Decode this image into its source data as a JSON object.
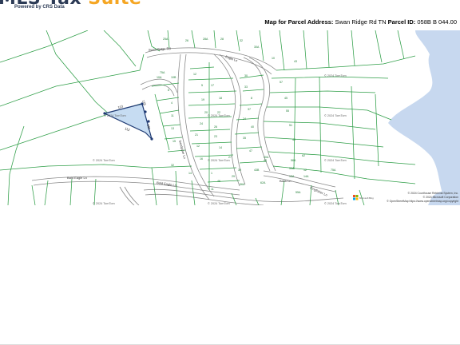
{
  "logo": {
    "title_main": "MLS Tax",
    "title_accent": "Suite",
    "tagline": "Powered by CRS Data"
  },
  "header": {
    "prefix": "Map for Parcel Address:",
    "address": "Swan Ridge Rd TN",
    "parcel_label": "Parcel ID:",
    "parcel_id": "058B B 044.00"
  },
  "map": {
    "watermark": "© 2024 TomTom",
    "roads": {
      "swan_ridge": "Swan Ridge Rd",
      "eagle": "Eagle Ln",
      "bald_eagle": "Bald Eagle Ln",
      "bald_eagle_2": "Bald Eagle Ln",
      "sandpiper": "Sandpiper Ln",
      "bass": "Bass Ln",
      "kingfisher": "Kingfisher Ln"
    },
    "parcel_dims": [
      "113",
      "181",
      "112",
      "175"
    ],
    "lot_labels": [
      "25A",
      "26",
      "28A",
      "28",
      "32",
      "30A",
      "10",
      "43",
      "75A",
      "10A",
      "10B",
      "12",
      "5",
      "17",
      "19",
      "18",
      "20",
      "22",
      "24",
      "26",
      "21",
      "23",
      "12",
      "14",
      "16",
      "30",
      "33",
      "8",
      "37",
      "24",
      "40",
      "35",
      "47",
      "42",
      "57",
      "45",
      "55",
      "51",
      "49",
      "62",
      "6",
      "4",
      "11",
      "13",
      "15",
      "27",
      "39",
      "40A",
      "29",
      "56A",
      "1",
      "46",
      "43B",
      "55A",
      "12",
      "13A",
      "14A",
      "55A",
      "75A",
      "32",
      "14",
      "11",
      "56A",
      "62A"
    ],
    "attribution": {
      "line1": "© 2024 Courthouse Retrieval System, Inc.",
      "line2": "© 2024 Microsoft Corporation",
      "line3": "© OpenStreetMap https://www.openstreetmap.org/copyright"
    },
    "ms_logo_text": "Microsoft Bing",
    "colors": {
      "parcel_line": "#2e9e47",
      "water": "#c7d8ef",
      "subject_fill": "#c6dcf2",
      "subject_stroke": "#1f3a73",
      "road_edge": "#8a8a8a"
    }
  }
}
